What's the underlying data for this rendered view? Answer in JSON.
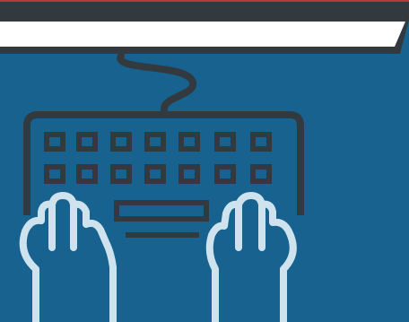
{
  "illustration": {
    "subject": "typing-on-keyboard",
    "colors": {
      "background": "#17628f",
      "dark": "#333a3f",
      "light": "#ffffff",
      "hands": "#cfe3ee",
      "accent": "#b33a40"
    },
    "icons": [
      "keyboard-icon",
      "hand-icon",
      "cable-icon"
    ]
  }
}
